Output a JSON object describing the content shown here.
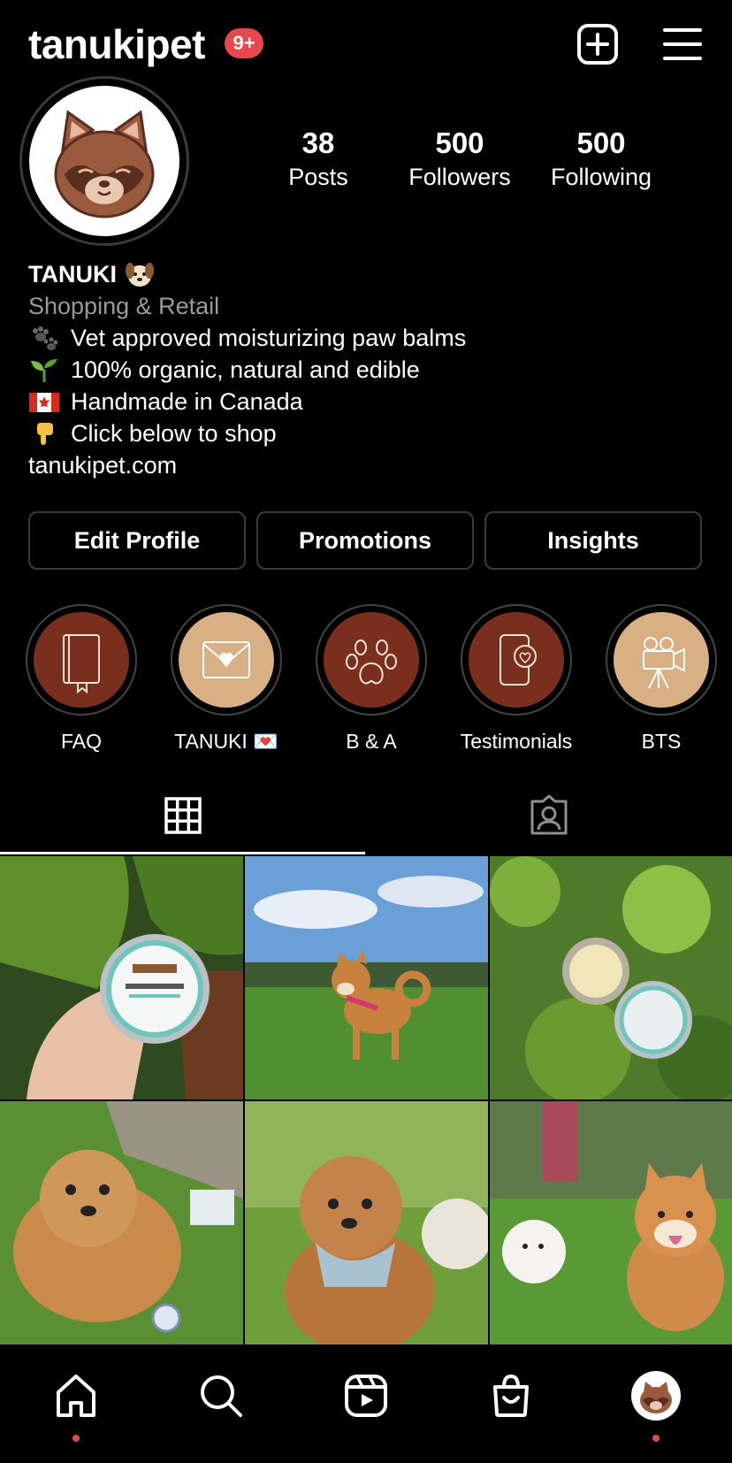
{
  "header": {
    "username": "tanukipet",
    "notification_badge": "9+",
    "icons": [
      "add-post-icon",
      "menu-icon"
    ]
  },
  "profile": {
    "stats": [
      {
        "value": "38",
        "label": "Posts"
      },
      {
        "value": "500",
        "label": "Followers"
      },
      {
        "value": "500",
        "label": "Following"
      }
    ],
    "name": "TANUKI",
    "name_emoji": "dog-face",
    "category": "Shopping & Retail",
    "bio_lines": [
      {
        "emoji": "paw-prints",
        "text": "Vet approved moisturizing paw balms"
      },
      {
        "emoji": "seedling",
        "text": "100% organic, natural and edible"
      },
      {
        "emoji": "canada-flag",
        "text": "Handmade in Canada"
      },
      {
        "emoji": "pointing-down",
        "text": "Click below to shop"
      }
    ],
    "website": "tanukipet.com"
  },
  "actions": {
    "edit_profile": "Edit Profile",
    "promotions": "Promotions",
    "insights": "Insights"
  },
  "highlights": [
    {
      "label": "FAQ",
      "icon": "book-icon",
      "color": "#7a2f1e"
    },
    {
      "label": "TANUKI 💌",
      "icon": "envelope-heart-icon",
      "color": "#d9b083"
    },
    {
      "label": "B & A",
      "icon": "paw-icon",
      "color": "#7a2f1e"
    },
    {
      "label": "Testimonials",
      "icon": "phone-heart-icon",
      "color": "#7a2f1e"
    },
    {
      "label": "BTS",
      "icon": "camera-icon",
      "color": "#d9b083"
    }
  ],
  "tabs": [
    "grid-icon",
    "tagged-icon"
  ],
  "posts": [
    "Hand holding NOURISH paw balm tin in front of monstera leaves",
    "Shiba inu standing in a grassy park",
    "Open paw balm tins on leafy greenery",
    "Fluffy poodle lying on grass beside a paw balm tin",
    "Curly dog wearing a blue bandana in a park",
    "Shiba inu and white puppy in a park"
  ],
  "bottom_nav": [
    "home-icon",
    "search-icon",
    "reels-icon",
    "shop-icon",
    "profile-avatar"
  ],
  "colors": {
    "accent_red": "#e5484d",
    "highlight_brown": "#7a2f1e",
    "highlight_tan": "#d9b083"
  }
}
